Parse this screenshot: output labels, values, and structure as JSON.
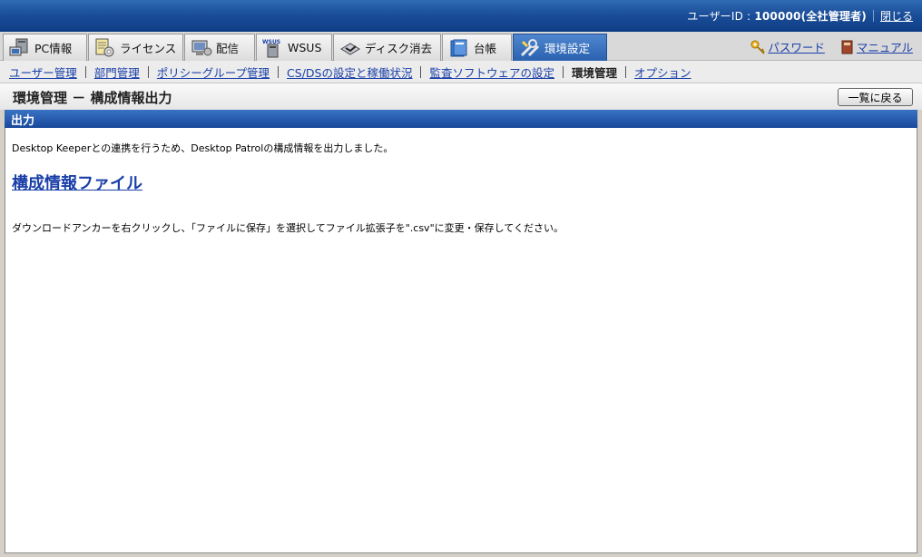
{
  "user": {
    "prefix": "ユーザーID : ",
    "id_text": "100000(全社管理者)",
    "close_label": "閉じる"
  },
  "tabs": [
    {
      "label": "PC情報",
      "icon": "pc-icon"
    },
    {
      "label": "ライセンス",
      "icon": "license-icon"
    },
    {
      "label": "配信",
      "icon": "delivery-icon"
    },
    {
      "label": "WSUS",
      "icon": "wsus-icon"
    },
    {
      "label": "ディスク消去",
      "icon": "disk-erase-icon"
    },
    {
      "label": "台帳",
      "icon": "ledger-icon"
    },
    {
      "label": "環境設定",
      "icon": "settings-tools-icon",
      "active": true
    }
  ],
  "right_links": {
    "password": "パスワード",
    "manual": "マニュアル"
  },
  "subnav": {
    "items": [
      "ユーザー管理",
      "部門管理",
      "ポリシーグループ管理",
      "CS/DSの設定と稼働状況",
      "監査ソフトウェアの設定",
      "環境管理",
      "オプション"
    ],
    "current_index": 5
  },
  "page": {
    "title": "環境管理 － 構成情報出力",
    "back_button": "一覧に戻る",
    "section_title": "出力",
    "message": "Desktop Keeperとの連携を行うため、Desktop Patrolの構成情報を出力しました。",
    "file_link": "構成情報ファイル",
    "note": "ダウンロードアンカーを右クリックし、「ファイルに保存」を選択してファイル拡張子を\".csv\"に変更・保存してください。"
  },
  "colors": {
    "topbar": "#1b4f9a",
    "active_tab": "#2a62b0",
    "section_header": "#18489a",
    "link": "#1a3fa8"
  }
}
